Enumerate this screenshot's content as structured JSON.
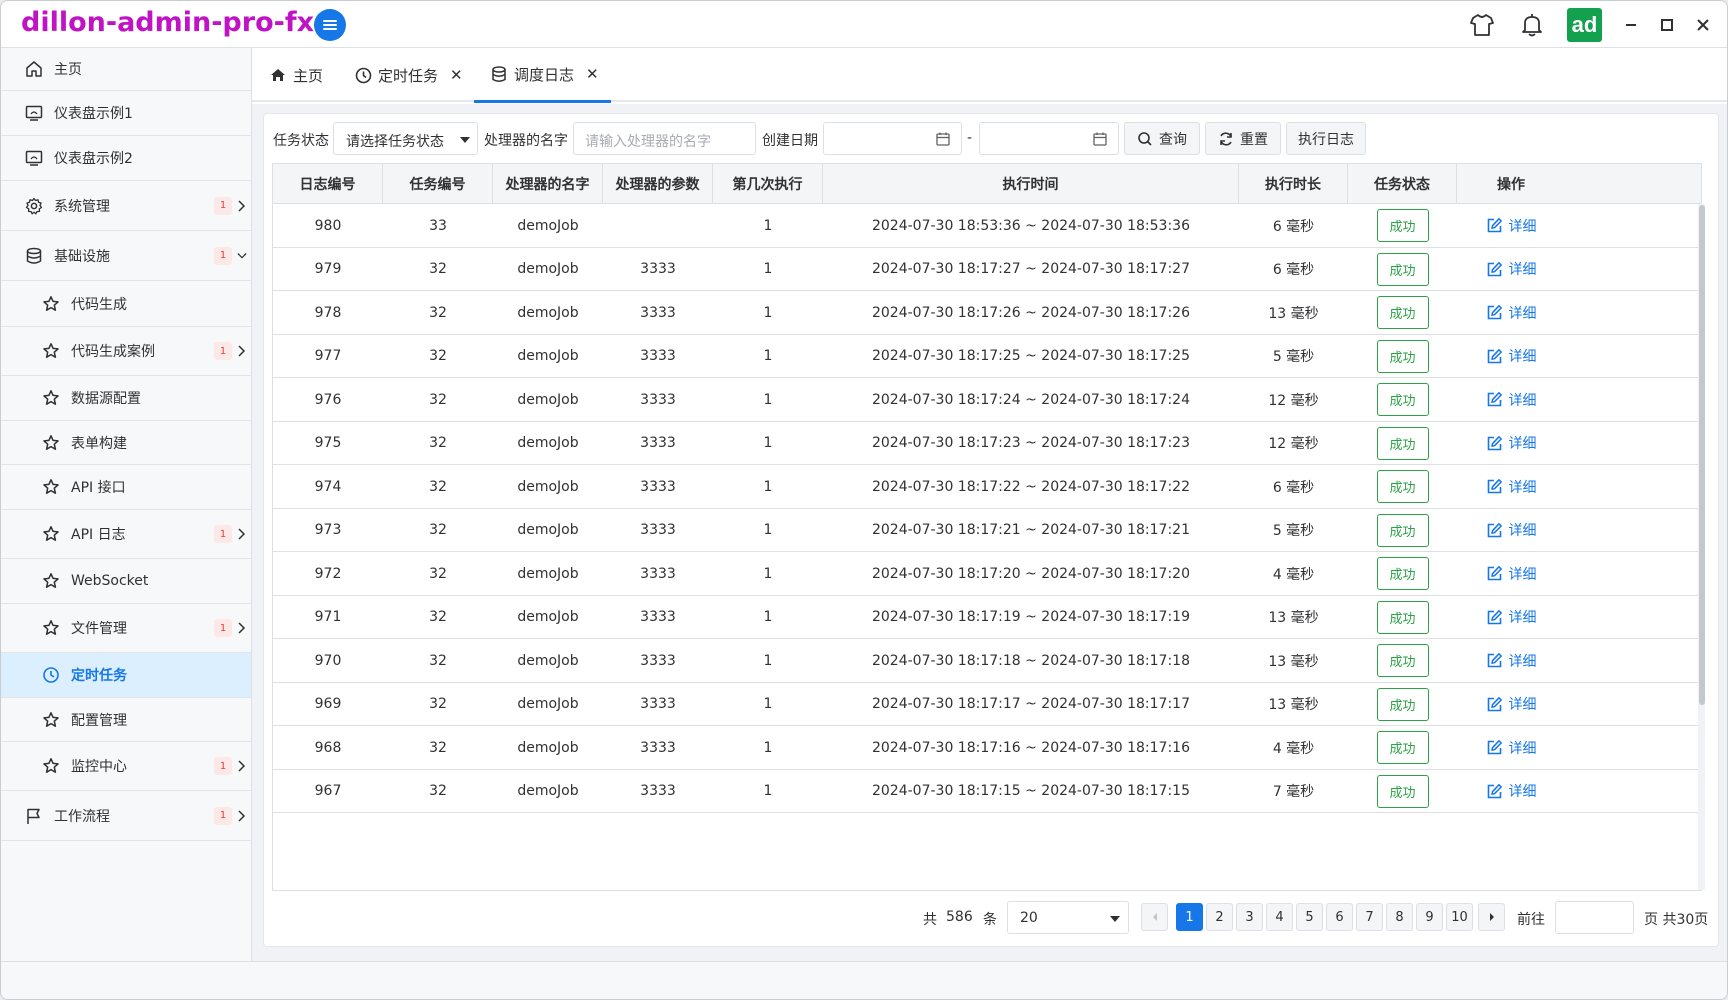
{
  "app": {
    "title": "dillon-admin-pro-fx",
    "avatar_text": "ad"
  },
  "colors": {
    "brand": "#c013c5",
    "primary": "#1677e8",
    "success": "#2ba245",
    "badge": "#e0423b"
  },
  "sidebar": {
    "items": [
      {
        "label": "主页",
        "icon": "home-icon"
      },
      {
        "label": "仪表盘示例1",
        "icon": "monitor-icon"
      },
      {
        "label": "仪表盘示例2",
        "icon": "monitor-icon"
      },
      {
        "label": "系统管理",
        "icon": "gear-icon",
        "badge": "1"
      },
      {
        "label": "基础设施",
        "icon": "database-icon",
        "badge": "1"
      },
      {
        "label": "代码生成",
        "icon": "star-icon"
      },
      {
        "label": "代码生成案例",
        "icon": "star-icon",
        "badge": "1"
      },
      {
        "label": "数据源配置",
        "icon": "star-icon"
      },
      {
        "label": "表单构建",
        "icon": "star-icon"
      },
      {
        "label": "API 接口",
        "icon": "star-icon"
      },
      {
        "label": "API 日志",
        "icon": "star-icon",
        "badge": "1"
      },
      {
        "label": "WebSocket",
        "icon": "star-icon"
      },
      {
        "label": "文件管理",
        "icon": "star-icon",
        "badge": "1"
      },
      {
        "label": "定时任务",
        "icon": "clock-icon"
      },
      {
        "label": "配置管理",
        "icon": "star-icon"
      },
      {
        "label": "监控中心",
        "icon": "star-icon",
        "badge": "1"
      },
      {
        "label": "工作流程",
        "icon": "flag-icon",
        "badge": "1"
      }
    ]
  },
  "tabs": [
    {
      "label": "主页",
      "icon": "home-icon"
    },
    {
      "label": "定时任务",
      "icon": "clock-icon",
      "close": "✕"
    },
    {
      "label": "调度日志",
      "icon": "database-icon",
      "close": "✕"
    }
  ],
  "search": {
    "status_label": "任务状态",
    "status_select": "请选择任务状态",
    "handler_label": "处理器的名字",
    "handler_placeholder": "请输入处理器的名字",
    "date_label": "创建日期",
    "date_sep": "-",
    "query_btn": "查询",
    "reset_btn": "重置",
    "log_btn": "执行日志"
  },
  "table": {
    "headers": [
      "日志编号",
      "任务编号",
      "处理器的名字",
      "处理器的参数",
      "第几次执行",
      "执行时间",
      "执行时长",
      "任务状态",
      "操作"
    ],
    "status_text": "成功",
    "action_text": "详细",
    "rows": [
      {
        "id": "980",
        "job": "33",
        "handler": "demoJob",
        "param": "",
        "times": "1",
        "time": "2024-07-30 18:53:36 ~ 2024-07-30 18:53:36",
        "duration": "6 毫秒"
      },
      {
        "id": "979",
        "job": "32",
        "handler": "demoJob",
        "param": "3333",
        "times": "1",
        "time": "2024-07-30 18:17:27 ~ 2024-07-30 18:17:27",
        "duration": "6 毫秒"
      },
      {
        "id": "978",
        "job": "32",
        "handler": "demoJob",
        "param": "3333",
        "times": "1",
        "time": "2024-07-30 18:17:26 ~ 2024-07-30 18:17:26",
        "duration": "13 毫秒"
      },
      {
        "id": "977",
        "job": "32",
        "handler": "demoJob",
        "param": "3333",
        "times": "1",
        "time": "2024-07-30 18:17:25 ~ 2024-07-30 18:17:25",
        "duration": "5 毫秒"
      },
      {
        "id": "976",
        "job": "32",
        "handler": "demoJob",
        "param": "3333",
        "times": "1",
        "time": "2024-07-30 18:17:24 ~ 2024-07-30 18:17:24",
        "duration": "12 毫秒"
      },
      {
        "id": "975",
        "job": "32",
        "handler": "demoJob",
        "param": "3333",
        "times": "1",
        "time": "2024-07-30 18:17:23 ~ 2024-07-30 18:17:23",
        "duration": "12 毫秒"
      },
      {
        "id": "974",
        "job": "32",
        "handler": "demoJob",
        "param": "3333",
        "times": "1",
        "time": "2024-07-30 18:17:22 ~ 2024-07-30 18:17:22",
        "duration": "6 毫秒"
      },
      {
        "id": "973",
        "job": "32",
        "handler": "demoJob",
        "param": "3333",
        "times": "1",
        "time": "2024-07-30 18:17:21 ~ 2024-07-30 18:17:21",
        "duration": "5 毫秒"
      },
      {
        "id": "972",
        "job": "32",
        "handler": "demoJob",
        "param": "3333",
        "times": "1",
        "time": "2024-07-30 18:17:20 ~ 2024-07-30 18:17:20",
        "duration": "4 毫秒"
      },
      {
        "id": "971",
        "job": "32",
        "handler": "demoJob",
        "param": "3333",
        "times": "1",
        "time": "2024-07-30 18:17:19 ~ 2024-07-30 18:17:19",
        "duration": "13 毫秒"
      },
      {
        "id": "970",
        "job": "32",
        "handler": "demoJob",
        "param": "3333",
        "times": "1",
        "time": "2024-07-30 18:17:18 ~ 2024-07-30 18:17:18",
        "duration": "13 毫秒"
      },
      {
        "id": "969",
        "job": "32",
        "handler": "demoJob",
        "param": "3333",
        "times": "1",
        "time": "2024-07-30 18:17:17 ~ 2024-07-30 18:17:17",
        "duration": "13 毫秒"
      },
      {
        "id": "968",
        "job": "32",
        "handler": "demoJob",
        "param": "3333",
        "times": "1",
        "time": "2024-07-30 18:17:16 ~ 2024-07-30 18:17:16",
        "duration": "4 毫秒"
      },
      {
        "id": "967",
        "job": "32",
        "handler": "demoJob",
        "param": "3333",
        "times": "1",
        "time": "2024-07-30 18:17:15 ~ 2024-07-30 18:17:15",
        "duration": "7 毫秒"
      }
    ]
  },
  "pagination": {
    "total_prefix": "共",
    "total": "586",
    "total_suffix": "条",
    "page_size": "20",
    "pages": [
      "1",
      "2",
      "3",
      "4",
      "5",
      "6",
      "7",
      "8",
      "9",
      "10"
    ],
    "current": "1",
    "goto_label": "前往",
    "page_suffix": "页 共30页"
  }
}
